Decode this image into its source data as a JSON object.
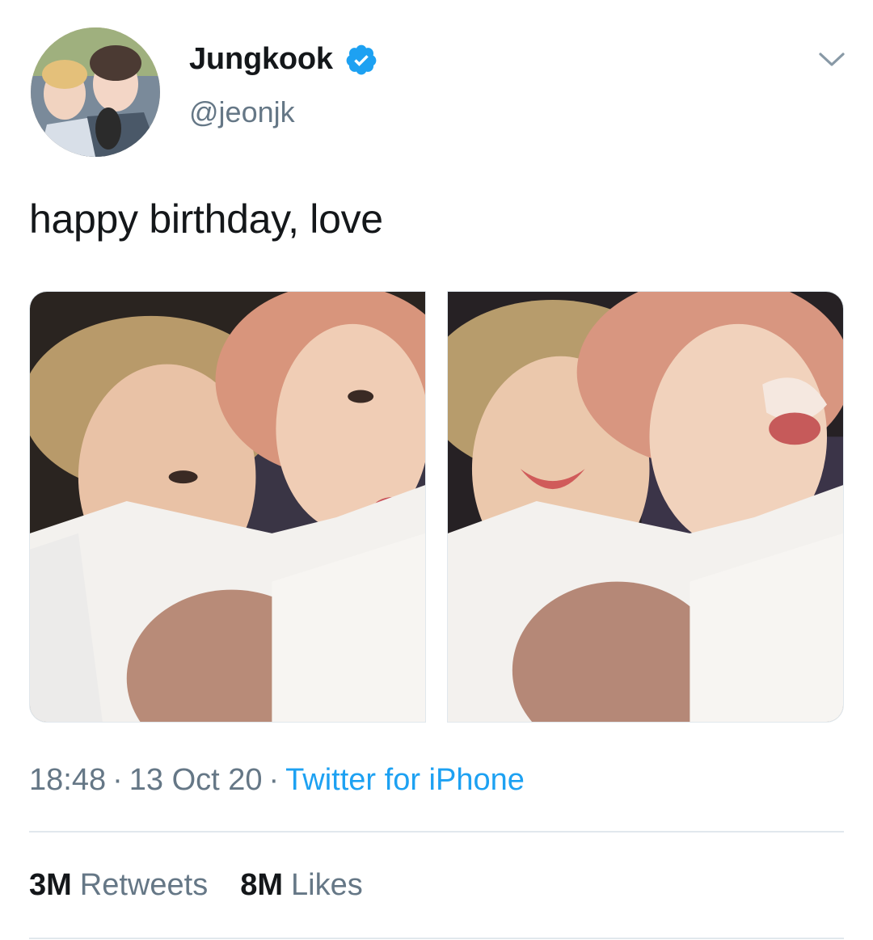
{
  "user": {
    "display_name": "Jungkook",
    "handle": "@jeonjk",
    "verified": true,
    "avatar_icon": "profile-avatar-photo"
  },
  "tweet": {
    "text": "happy birthday, love",
    "photos": [
      {
        "icon": "selfie-photo-1"
      },
      {
        "icon": "selfie-photo-2"
      }
    ]
  },
  "meta": {
    "time": "18:48",
    "separator": "·",
    "date": "13 Oct 20",
    "source": "Twitter for iPhone"
  },
  "stats": {
    "retweets_count": "3M",
    "retweets_label": "Retweets",
    "likes_count": "8M",
    "likes_label": "Likes"
  },
  "colors": {
    "accent": "#1da1f2",
    "secondary_text": "#657786",
    "primary_text": "#14171a",
    "divider": "#e1e8ed"
  }
}
